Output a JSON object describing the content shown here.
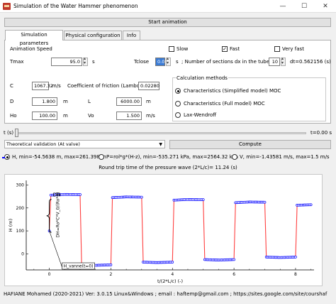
{
  "window": {
    "title": "Simulation of the Water Hammer phenomenon",
    "minimize": "—",
    "maximize": "☐",
    "close": "✕"
  },
  "buttons": {
    "start_animation": "Start animation",
    "compute": "Compute"
  },
  "tabs": [
    {
      "label": "Simulation parameters",
      "active": true
    },
    {
      "label": "Physical configuration",
      "active": false
    },
    {
      "label": "Info",
      "active": false
    }
  ],
  "params": {
    "animation_speed_label": "Animation Speed",
    "speed_options": [
      {
        "label": "Slow",
        "checked": false
      },
      {
        "label": "Fast",
        "checked": true
      },
      {
        "label": "Very fast",
        "checked": false
      }
    ],
    "tmax_label": "Tmax",
    "tmax_value": "95.0",
    "tmax_unit": "s",
    "tclose_label": "Tclose",
    "tclose_value": "0.0",
    "tclose_unit": "s",
    "sections_label": "; Number of sections dx in the tube",
    "sections_value": "10",
    "dt_label": "dt=0.562156 (s)",
    "c_label": "C",
    "c_value": "1067.32",
    "c_unit": "m/s",
    "lambda_label": "Coefficient of friction (Lambda)",
    "lambda_value": "0.02280",
    "d_label": "D",
    "d_value": "1.800",
    "d_unit": "m",
    "l_label": "L",
    "l_value": "6000.00",
    "l_unit": "m",
    "ho_label": "Ho",
    "ho_value": "100.00",
    "ho_unit": "m",
    "vo_label": "Vo",
    "vo_value": "1.500",
    "vo_unit": "m/s"
  },
  "methods": {
    "title": "Calculation methods",
    "options": [
      {
        "label": "Characteristics (Simplified model) MOC",
        "selected": true
      },
      {
        "label": "Characteristics (Full model) MOC",
        "selected": false
      },
      {
        "label": "Lax-Wendroff",
        "selected": false
      }
    ]
  },
  "time_slider": {
    "left_label": "t (s)",
    "right_label": "t=0.00 s",
    "fraction": 0.0
  },
  "validation_select": {
    "value": "Theoretical validation (At valve)"
  },
  "legend": {
    "h": {
      "label": "H, min=-54.5638 m, max=261.398 m",
      "selected": true,
      "color": "#0000ff"
    },
    "p": {
      "label": "P=rol*g*(H-z), min=-535.271 kPa, max=2564.32 kPa",
      "selected": false
    },
    "v": {
      "label": "V, min=-1.43581 m/s, max=1.5 m/s",
      "selected": false
    }
  },
  "round_trip": "Round trip time of the pressure wave (2*L/c)= 11.24 (s)",
  "chart_data": {
    "type": "line",
    "xlabel": "t/(2*L/c) (-)",
    "ylabel": "H (m)",
    "xlim": [
      -0.75,
      8.6
    ],
    "ylim": [
      -70,
      320
    ],
    "xticks": [
      0,
      2,
      4,
      6,
      8
    ],
    "yticks": [
      0,
      100,
      200,
      300
    ],
    "grid": false,
    "annotations": [
      "DH",
      "DH=Ro*C*V_0/(Ro*g)",
      "H_vanne(t=0)"
    ],
    "colors": {
      "theory": "#ff4040",
      "markers": "#0000ff"
    },
    "series": [
      {
        "x": [
          0,
          0.05,
          0.5,
          1.0,
          1.05,
          1.5,
          2.0,
          2.05,
          2.5,
          3.0,
          3.05,
          3.5,
          4.0,
          4.05,
          4.5,
          5.0,
          5.05,
          5.5,
          6.0,
          6.05,
          6.5,
          7.0,
          7.05,
          7.5,
          8.0,
          8.05,
          8.5
        ],
        "y": [
          100,
          256,
          259,
          258,
          -48,
          -50,
          -48,
          245,
          248,
          247,
          -36,
          -38,
          -36,
          234,
          237,
          236,
          -25,
          -27,
          -25,
          223,
          226,
          225,
          -14,
          -16,
          -14,
          212,
          214
        ]
      }
    ]
  },
  "status_bar": "HAFIANE Mohamed (2020-2021) Ver: 3.0.15 Linux&Windows ; email : haftemp@gmail.com ; https://sites.google.com/site/courshaf"
}
